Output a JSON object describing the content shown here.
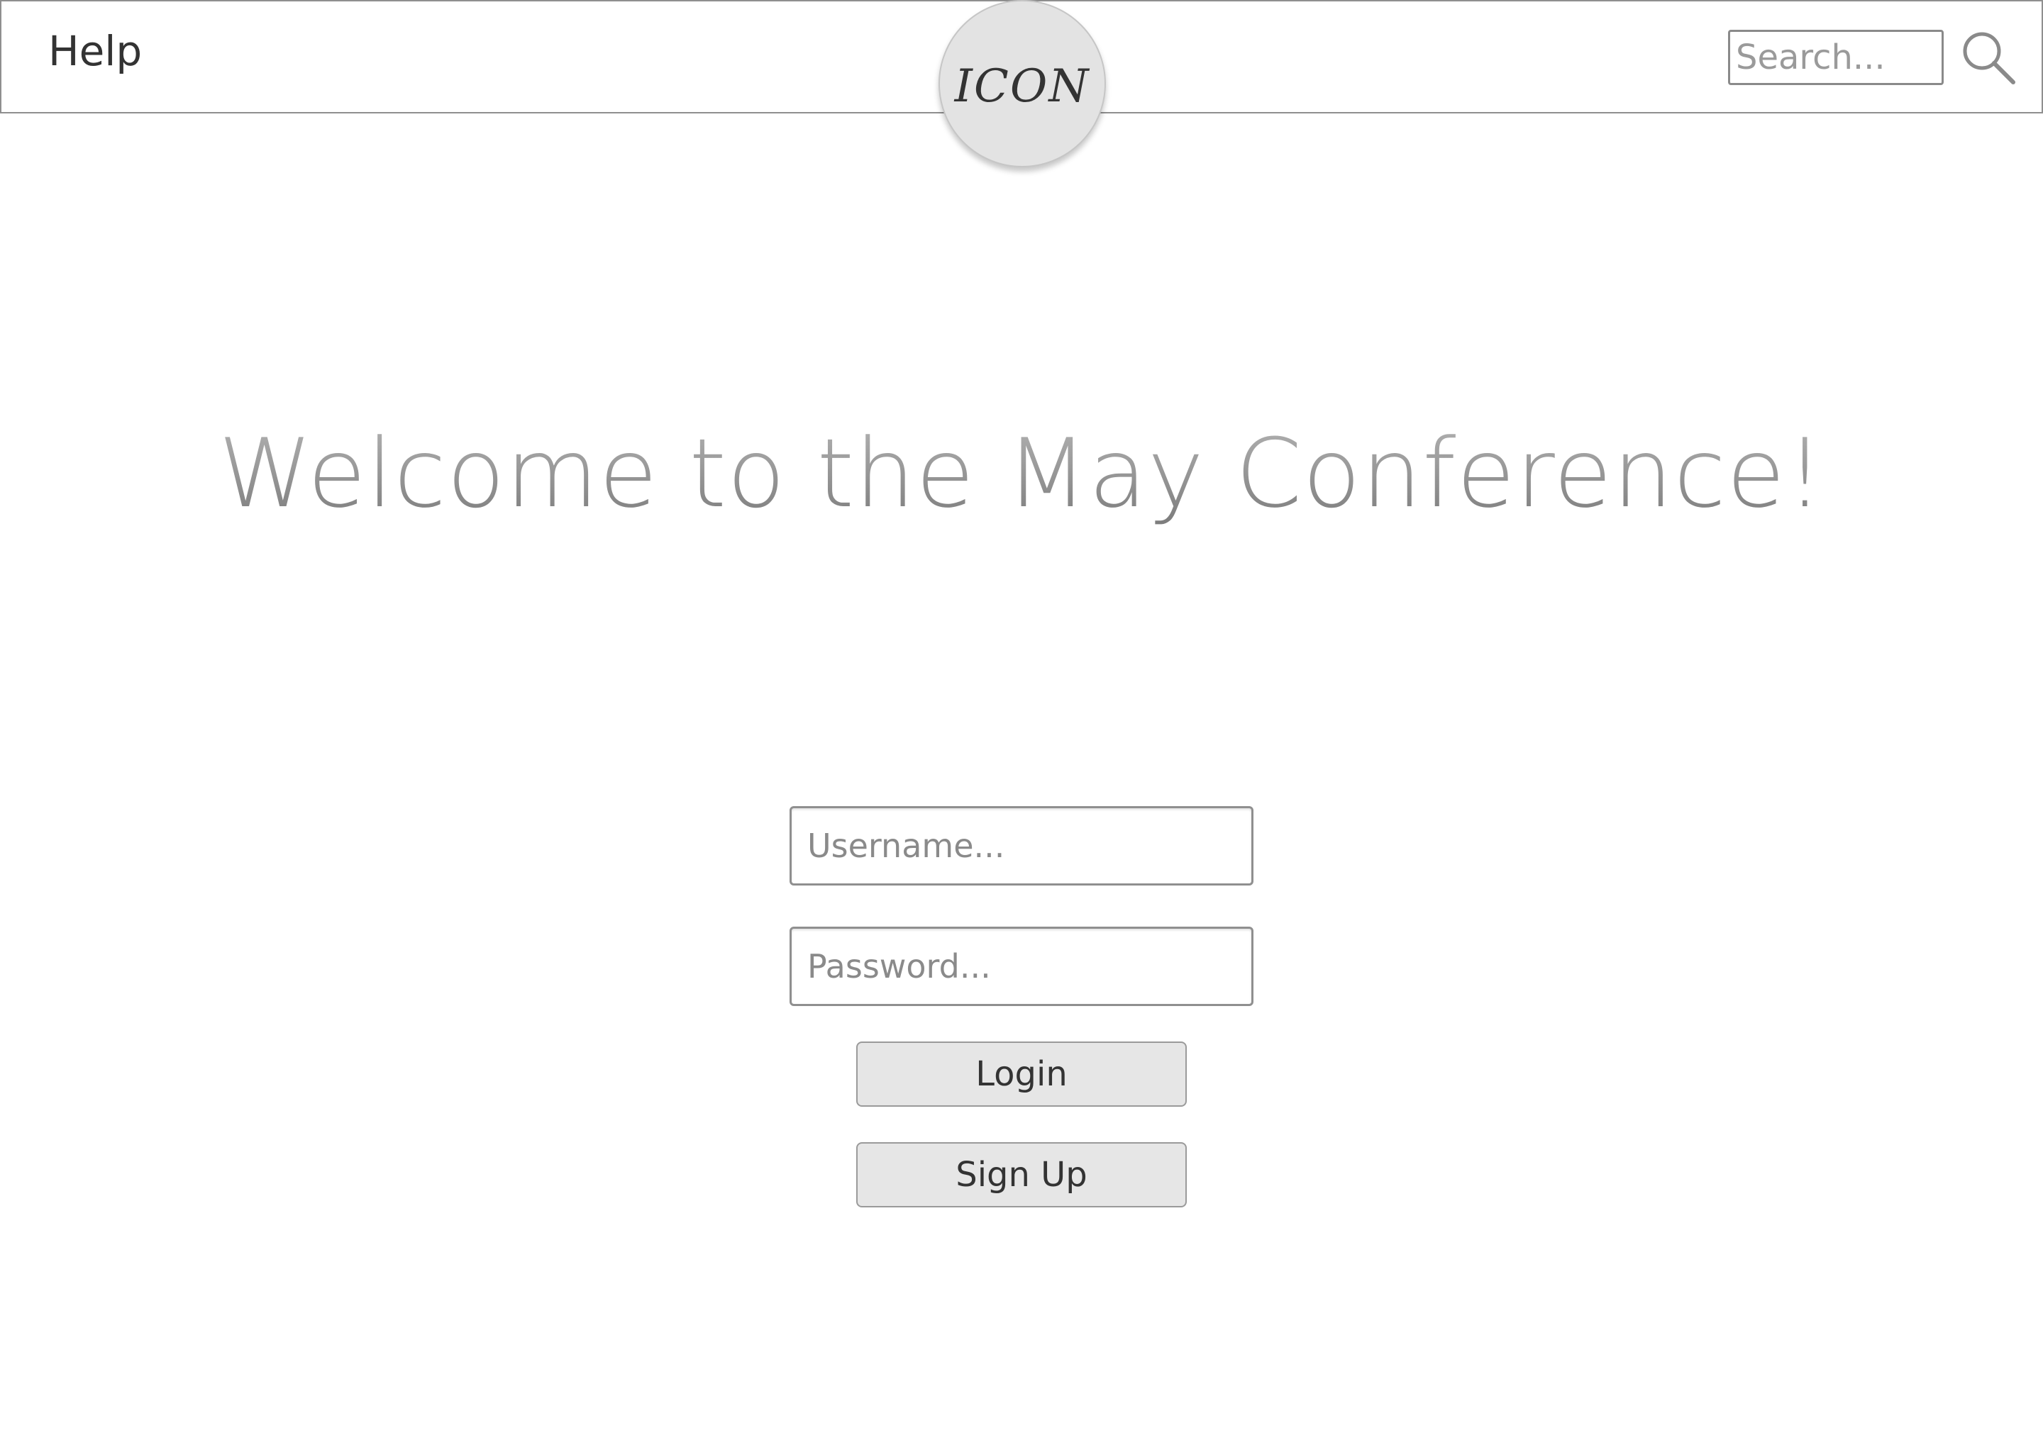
{
  "header": {
    "help_label": "Help",
    "logo_text": "ICON",
    "search": {
      "placeholder": "Search...",
      "icon": "search-icon"
    }
  },
  "main": {
    "headline": "Welcome to the May Conference!"
  },
  "login_form": {
    "username": {
      "placeholder": "Username...",
      "value": ""
    },
    "password": {
      "placeholder": "Password...",
      "value": ""
    },
    "login_label": "Login",
    "signup_label": "Sign Up"
  },
  "colors": {
    "background": "#ffffff",
    "border": "#8f8f8f",
    "button_fill": "#e6e6e6",
    "logo_fill": "#e3e3e3",
    "headline_gray": "#8c8c8c",
    "text": "#333333"
  }
}
